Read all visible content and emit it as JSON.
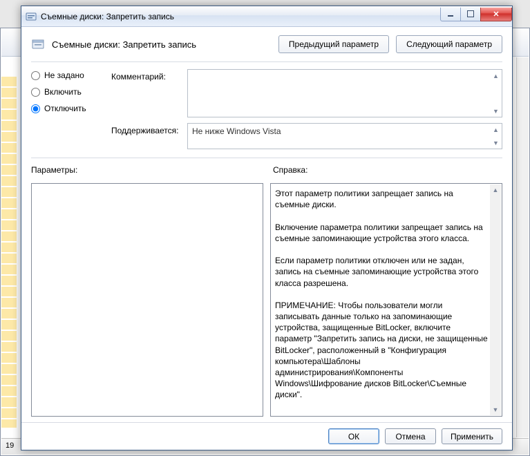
{
  "window": {
    "title": "Съемные диски: Запретить запись"
  },
  "header": {
    "title": "Съемные диски: Запретить запись",
    "prev_label": "Предыдущий параметр",
    "next_label": "Следующий параметр"
  },
  "radios": {
    "not_configured": "Не задано",
    "enabled": "Включить",
    "disabled": "Отключить",
    "selected": "disabled"
  },
  "fields": {
    "comment_label": "Комментарий:",
    "comment_value": "",
    "supported_label": "Поддерживается:",
    "supported_value": "Не ниже Windows Vista"
  },
  "sections": {
    "options_label": "Параметры:",
    "help_label": "Справка:"
  },
  "help_text": "Этот параметр политики запрещает запись на съемные диски.\n\nВключение параметра политики запрещает запись на съемные запоминающие устройства этого класса.\n\nЕсли параметр политики отключен или не задан, запись на съемные запоминающие устройства этого класса разрешена.\n\nПРИМЕЧАНИЕ: Чтобы пользователи могли записывать данные только на запоминающие устройства, защищенные BitLocker, включите параметр \"Запретить запись на диски, не защищенные BitLocker\", расположенный в \"Конфигурация компьютера\\Шаблоны администрирования\\Компоненты Windows\\Шифрование дисков BitLocker\\Съемные диски\".",
  "footer": {
    "ok": "ОК",
    "cancel": "Отмена",
    "apply": "Применить"
  },
  "bg": {
    "status_count": "19"
  }
}
